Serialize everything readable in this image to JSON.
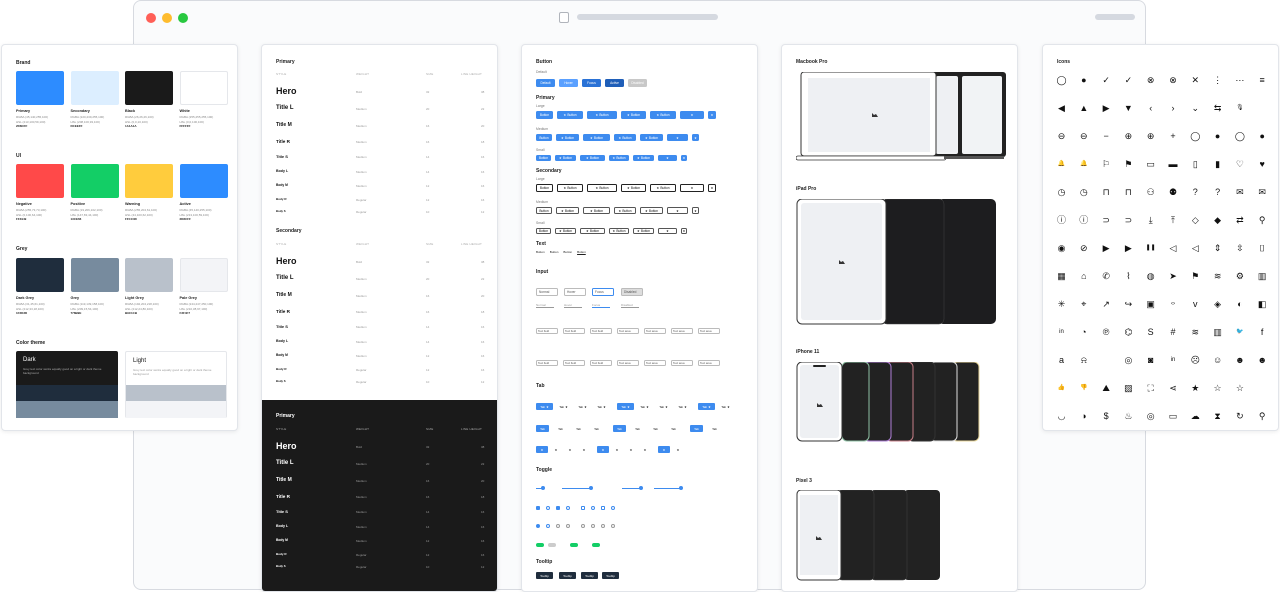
{
  "window": {
    "title": ""
  },
  "colors": {
    "brand_title": "Brand",
    "brand": [
      {
        "name": "Primary",
        "rgba": "RGBA (45,140,255,100)",
        "hsl": "HSL (213,100,59,100)",
        "hex": "2D8CFF",
        "color": "#2D8CFF"
      },
      {
        "name": "Secondary",
        "rgba": "RGBA (220,239,255,100)",
        "hsl": "HSL (208,100,93,100)",
        "hex": "DCEEFF",
        "color": "#DCEEFF"
      },
      {
        "name": "Black",
        "rgba": "RGBA (26,26,26,100)",
        "hsl": "HSL (0,0,10,100)",
        "hex": "1A1A1A",
        "color": "#1A1A1A"
      },
      {
        "name": "White",
        "rgba": "RGBA (255,255,255,100)",
        "hsl": "HSL (0,0,100,100)",
        "hex": "FFFFFF",
        "color": "#FFFFFF"
      }
    ],
    "ui_title": "UI",
    "ui": [
      {
        "name": "Negative",
        "rgba": "RGBA (255,73,73,100)",
        "hsl": "HSL (0,100,64,100)",
        "hex": "FF4949",
        "color": "#FF4949"
      },
      {
        "name": "Positive",
        "rgba": "RGBA (19,206,102,100)",
        "hsl": "HSL (147,83,44,100)",
        "hex": "13CE66",
        "color": "#13CE66"
      },
      {
        "name": "Warning",
        "rgba": "RGBA (255,204,61,100)",
        "hsl": "HSL (44,100,62,100)",
        "hex": "FFCC3D",
        "color": "#FFCC3D"
      },
      {
        "name": "Active",
        "rgba": "RGBA (45,140,255,100)",
        "hsl": "HSL (213,100,59,100)",
        "hex": "2D8CFF",
        "color": "#2D8CFF"
      }
    ],
    "grey_title": "Grey",
    "grey": [
      {
        "name": "Dark Grey",
        "rgba": "RGBA (31,45,61,100)",
        "hsl": "HSL (212,33,18,100)",
        "hex": "1F2D3D",
        "color": "#1F2D3D"
      },
      {
        "name": "Grey",
        "rgba": "RGBA (119,139,158,100)",
        "hsl": "HSL (209,15,54,100)",
        "hex": "778B9E",
        "color": "#778B9E"
      },
      {
        "name": "Light Grey",
        "rgba": "RGBA (192,204,218,100)",
        "hsl": "HSL (212,24,80,100)",
        "hex": "B9C1CB",
        "color": "#B9C1CB"
      },
      {
        "name": "Pale Grey",
        "rgba": "RGBA (244,247,250,100)",
        "hsl": "HSL (210,38,97,100)",
        "hex": "F3F4F7",
        "color": "#F3F4F7"
      }
    ],
    "theme_title": "Color theme",
    "dark_title": "Dark",
    "dark_desc": "Grey text color works equally good on a light or dark theme background",
    "light_title": "Light",
    "light_desc": "Grey text color works equally good on a light or dark theme background"
  },
  "typo": {
    "primary": "Primary",
    "secondary": "Secondary",
    "headers": [
      "STYLE",
      "WEIGHT",
      "SIZE",
      "LINE HEIGHT"
    ],
    "rows": [
      {
        "name": "Hero",
        "weight": "Bold",
        "size": "32",
        "lh": "38"
      },
      {
        "name": "Title L",
        "weight": "Medium",
        "size": "20",
        "lh": "22"
      },
      {
        "name": "Title M",
        "weight": "Medium",
        "size": "16",
        "lh": "20"
      },
      {
        "name": "Title R",
        "weight": "Medium",
        "size": "16",
        "lh": "18"
      },
      {
        "name": "Title S",
        "weight": "Medium",
        "size": "14",
        "lh": "16"
      },
      {
        "name": "Body L",
        "weight": "Medium",
        "size": "14",
        "lh": "16"
      },
      {
        "name": "Body M",
        "weight": "Medium",
        "size": "12",
        "lh": "16"
      },
      {
        "name": "Body R",
        "weight": "Regular",
        "size": "12",
        "lh": "16"
      },
      {
        "name": "Body S",
        "weight": "Regular",
        "size": "10",
        "lh": "12"
      }
    ]
  },
  "components": {
    "button": "Button",
    "primary": "Primary",
    "secondary": "Secondary",
    "text": "Text",
    "input": "Input",
    "tab": "Tab",
    "toggle": "Toggle",
    "tooltip": "Tooltip",
    "btn_label": "Button",
    "states": [
      "Default",
      "Hover",
      "Focus",
      "Active",
      "Disabled"
    ],
    "input_states": [
      "Normal",
      "Hover",
      "Focus",
      "Disabled"
    ],
    "text_field": "Text field",
    "text_area": "Text area",
    "tab_label": "Tab",
    "tooltip_label": "Tooltip",
    "sizes": [
      "Large",
      "Medium",
      "Small"
    ]
  },
  "devices": [
    {
      "title": "Macbook Pro"
    },
    {
      "title": "iPad Pro"
    },
    {
      "title": "iPhone 11"
    },
    {
      "title": "Pixel 3"
    }
  ],
  "icons": {
    "title": "Icons"
  }
}
